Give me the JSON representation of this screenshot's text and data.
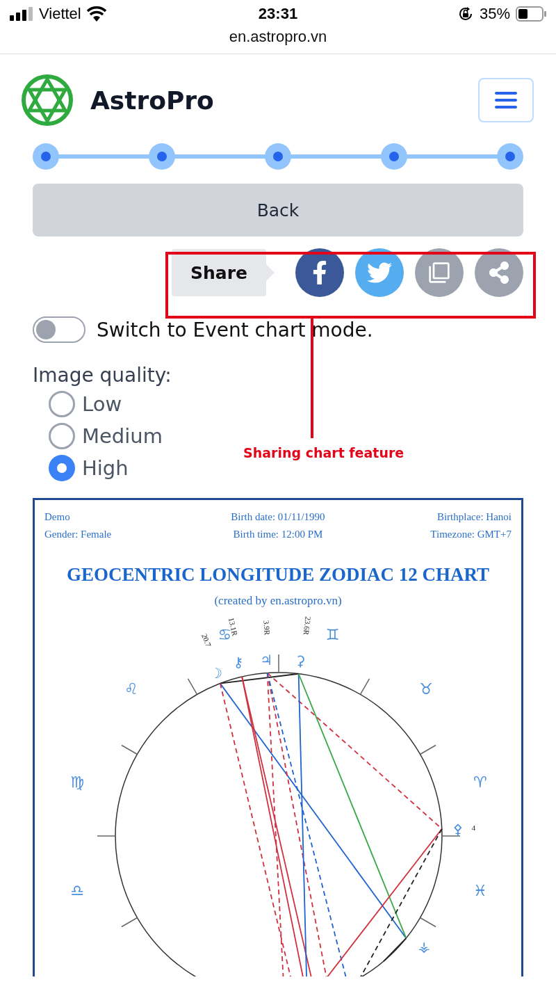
{
  "status_bar": {
    "carrier": "Viettel",
    "time": "23:31",
    "battery": "35%",
    "url": "en.astropro.vn"
  },
  "header": {
    "brand": "AstroPro"
  },
  "stepper": {
    "steps": [
      {
        "completed": true
      },
      {
        "completed": true
      },
      {
        "completed": true
      },
      {
        "completed": true
      },
      {
        "completed": true
      }
    ]
  },
  "back_button": {
    "label": "Back"
  },
  "share": {
    "label": "Share",
    "buttons": [
      {
        "kind": "facebook"
      },
      {
        "kind": "twitter"
      },
      {
        "kind": "copy"
      },
      {
        "kind": "share"
      }
    ]
  },
  "annotation": {
    "text": "Sharing chart feature"
  },
  "event_mode": {
    "label": "Switch to Event chart mode.",
    "on": false
  },
  "image_quality": {
    "label": "Image quality:",
    "options": [
      {
        "label": "Low",
        "selected": false
      },
      {
        "label": "Medium",
        "selected": false
      },
      {
        "label": "High",
        "selected": true
      }
    ]
  },
  "chart": {
    "info_left": [
      "Demo",
      "Gender: Female"
    ],
    "info_center": [
      "Birth date: 01/11/1990",
      "Birth time: 12:00 PM"
    ],
    "info_right": [
      "Birthplace: Hanoi",
      "Timezone: GMT+7"
    ],
    "title": "GEOCENTRIC LONGITUDE ZODIAC 12 CHART",
    "subtitle": "(created by en.astropro.vn)",
    "signs": [
      "♋",
      "♊",
      "♌",
      "♉",
      "♍",
      "♈",
      "♎",
      "♓"
    ],
    "planets": [
      {
        "glyph": "☽",
        "label": "20.7"
      },
      {
        "glyph": "⚷",
        "label": "13.1R"
      },
      {
        "glyph": "♃",
        "label": "3.9R"
      },
      {
        "glyph": "⚳",
        "label": "23.6R"
      },
      {
        "glyph": "⚴",
        "label": "4"
      },
      {
        "glyph": "⚶"
      }
    ]
  }
}
